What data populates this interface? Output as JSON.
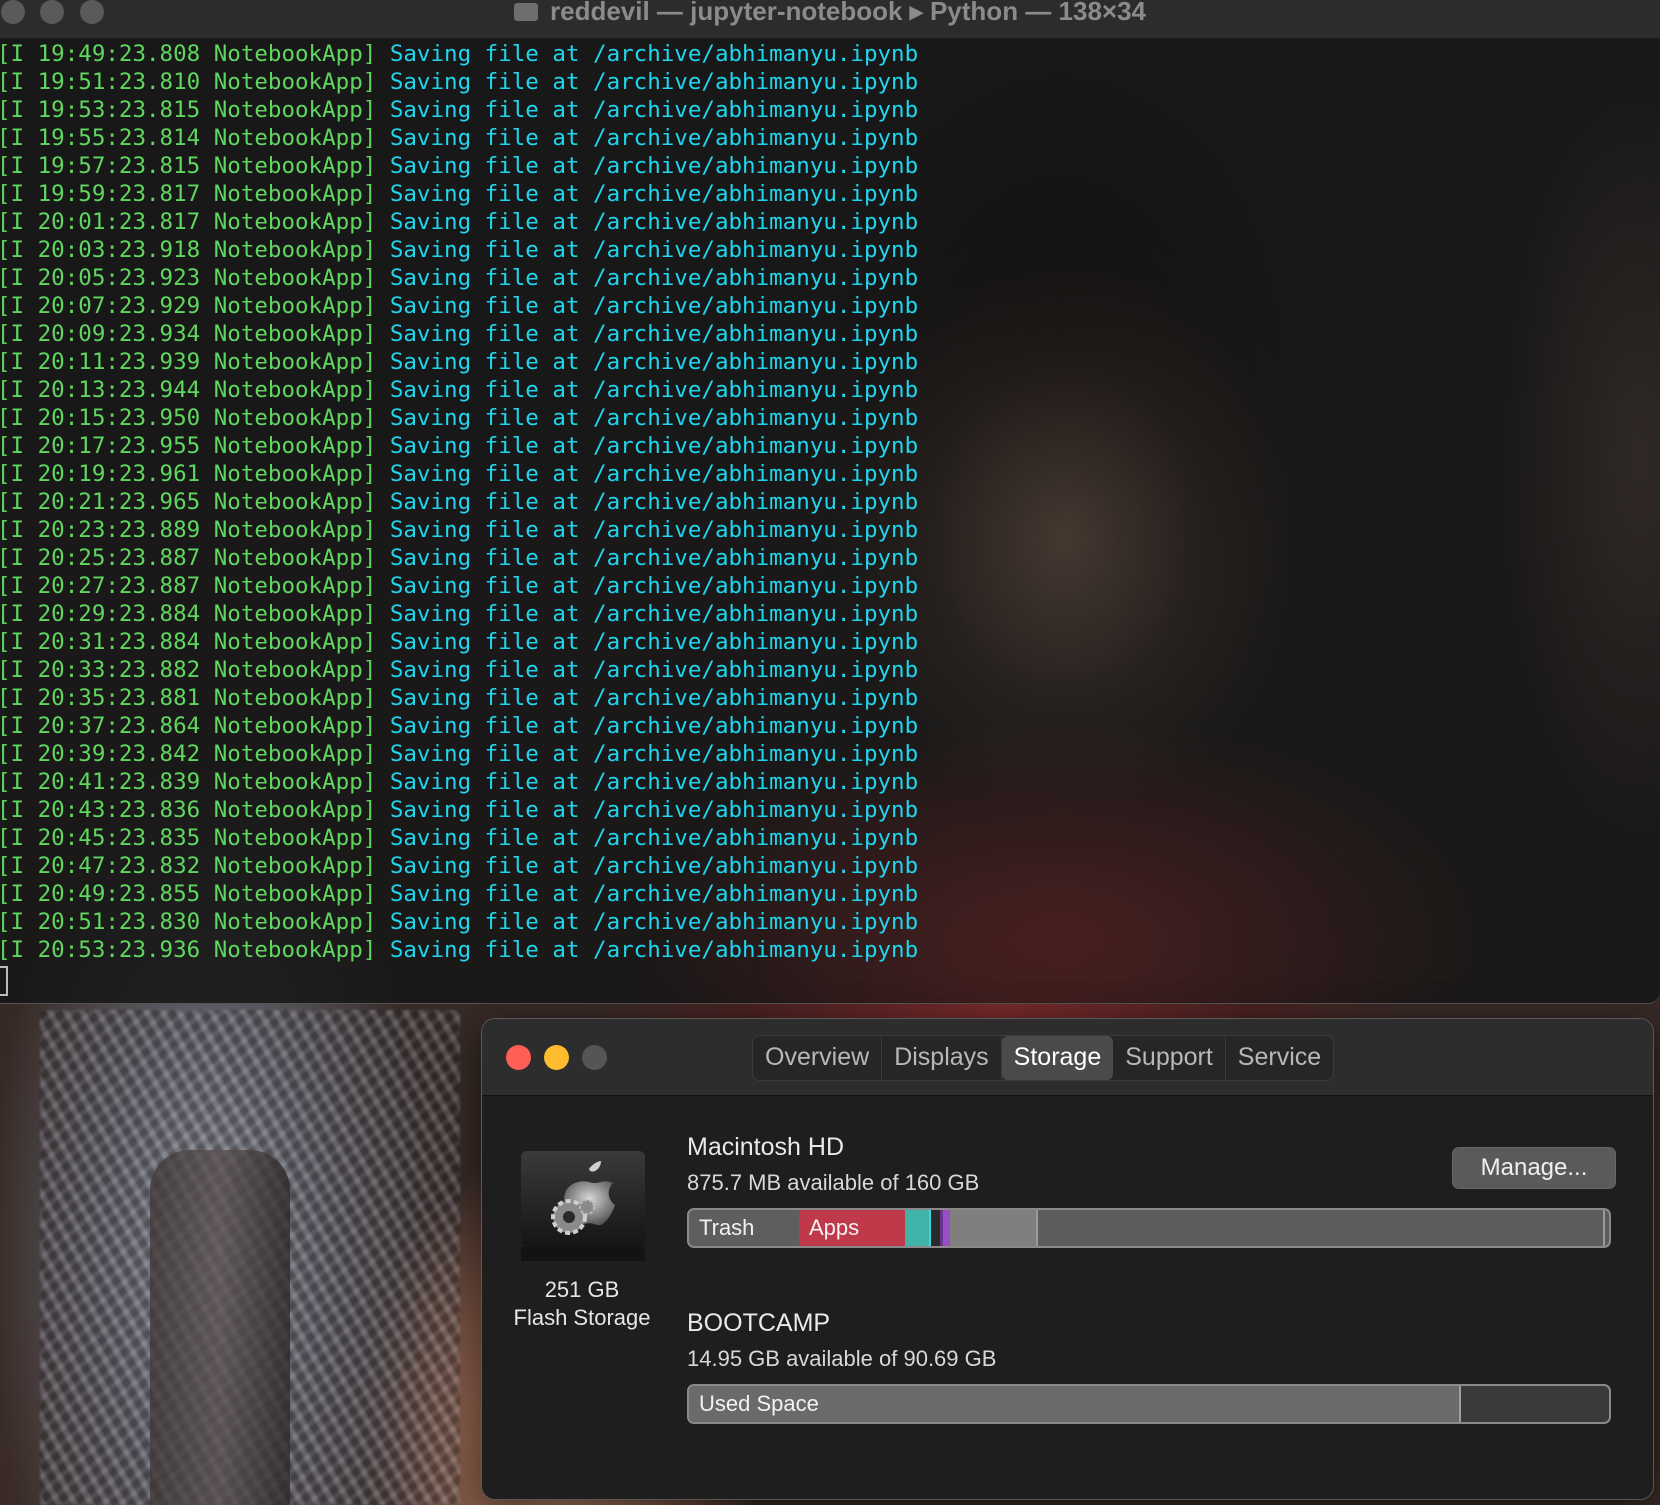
{
  "terminal": {
    "title": "reddevil — jupyter-notebook ▸ Python — 138×34",
    "lines": [
      {
        "prefix": "[I 19:49:23.808 NotebookApp]",
        "message": " Saving file at /archive/abhimanyu.ipynb"
      },
      {
        "prefix": "[I 19:51:23.810 NotebookApp]",
        "message": " Saving file at /archive/abhimanyu.ipynb"
      },
      {
        "prefix": "[I 19:53:23.815 NotebookApp]",
        "message": " Saving file at /archive/abhimanyu.ipynb"
      },
      {
        "prefix": "[I 19:55:23.814 NotebookApp]",
        "message": " Saving file at /archive/abhimanyu.ipynb"
      },
      {
        "prefix": "[I 19:57:23.815 NotebookApp]",
        "message": " Saving file at /archive/abhimanyu.ipynb"
      },
      {
        "prefix": "[I 19:59:23.817 NotebookApp]",
        "message": " Saving file at /archive/abhimanyu.ipynb"
      },
      {
        "prefix": "[I 20:01:23.817 NotebookApp]",
        "message": " Saving file at /archive/abhimanyu.ipynb"
      },
      {
        "prefix": "[I 20:03:23.918 NotebookApp]",
        "message": " Saving file at /archive/abhimanyu.ipynb"
      },
      {
        "prefix": "[I 20:05:23.923 NotebookApp]",
        "message": " Saving file at /archive/abhimanyu.ipynb"
      },
      {
        "prefix": "[I 20:07:23.929 NotebookApp]",
        "message": " Saving file at /archive/abhimanyu.ipynb"
      },
      {
        "prefix": "[I 20:09:23.934 NotebookApp]",
        "message": " Saving file at /archive/abhimanyu.ipynb"
      },
      {
        "prefix": "[I 20:11:23.939 NotebookApp]",
        "message": " Saving file at /archive/abhimanyu.ipynb"
      },
      {
        "prefix": "[I 20:13:23.944 NotebookApp]",
        "message": " Saving file at /archive/abhimanyu.ipynb"
      },
      {
        "prefix": "[I 20:15:23.950 NotebookApp]",
        "message": " Saving file at /archive/abhimanyu.ipynb"
      },
      {
        "prefix": "[I 20:17:23.955 NotebookApp]",
        "message": " Saving file at /archive/abhimanyu.ipynb"
      },
      {
        "prefix": "[I 20:19:23.961 NotebookApp]",
        "message": " Saving file at /archive/abhimanyu.ipynb"
      },
      {
        "prefix": "[I 20:21:23.965 NotebookApp]",
        "message": " Saving file at /archive/abhimanyu.ipynb"
      },
      {
        "prefix": "[I 20:23:23.889 NotebookApp]",
        "message": " Saving file at /archive/abhimanyu.ipynb"
      },
      {
        "prefix": "[I 20:25:23.887 NotebookApp]",
        "message": " Saving file at /archive/abhimanyu.ipynb"
      },
      {
        "prefix": "[I 20:27:23.887 NotebookApp]",
        "message": " Saving file at /archive/abhimanyu.ipynb"
      },
      {
        "prefix": "[I 20:29:23.884 NotebookApp]",
        "message": " Saving file at /archive/abhimanyu.ipynb"
      },
      {
        "prefix": "[I 20:31:23.884 NotebookApp]",
        "message": " Saving file at /archive/abhimanyu.ipynb"
      },
      {
        "prefix": "[I 20:33:23.882 NotebookApp]",
        "message": " Saving file at /archive/abhimanyu.ipynb"
      },
      {
        "prefix": "[I 20:35:23.881 NotebookApp]",
        "message": " Saving file at /archive/abhimanyu.ipynb"
      },
      {
        "prefix": "[I 20:37:23.864 NotebookApp]",
        "message": " Saving file at /archive/abhimanyu.ipynb"
      },
      {
        "prefix": "[I 20:39:23.842 NotebookApp]",
        "message": " Saving file at /archive/abhimanyu.ipynb"
      },
      {
        "prefix": "[I 20:41:23.839 NotebookApp]",
        "message": " Saving file at /archive/abhimanyu.ipynb"
      },
      {
        "prefix": "[I 20:43:23.836 NotebookApp]",
        "message": " Saving file at /archive/abhimanyu.ipynb"
      },
      {
        "prefix": "[I 20:45:23.835 NotebookApp]",
        "message": " Saving file at /archive/abhimanyu.ipynb"
      },
      {
        "prefix": "[I 20:47:23.832 NotebookApp]",
        "message": " Saving file at /archive/abhimanyu.ipynb"
      },
      {
        "prefix": "[I 20:49:23.855 NotebookApp]",
        "message": " Saving file at /archive/abhimanyu.ipynb"
      },
      {
        "prefix": "[I 20:51:23.830 NotebookApp]",
        "message": " Saving file at /archive/abhimanyu.ipynb"
      },
      {
        "prefix": "[I 20:53:23.936 NotebookApp]",
        "message": " Saving file at /archive/abhimanyu.ipynb"
      }
    ],
    "colors": {
      "prefix": "#5fd75f",
      "message": "#1fd6ee"
    }
  },
  "about": {
    "tabs": [
      "Overview",
      "Displays",
      "Storage",
      "Support",
      "Service"
    ],
    "active_tab": "Storage",
    "device": {
      "capacity": "251 GB",
      "type": "Flash Storage",
      "icon": "hard-drive-icon"
    },
    "volumes": [
      {
        "name": "Macintosh HD",
        "available": "875.7 MB available of 160 GB",
        "manage_label": "Manage...",
        "segments": [
          {
            "label": "Trash",
            "color": "#5e5e5e"
          },
          {
            "label": "Apps",
            "color": "#c0394a"
          },
          {
            "label": "",
            "color": "#3fb3a8"
          },
          {
            "label": "",
            "color": "#3fd2e8"
          },
          {
            "label": "",
            "color": "#9a4fc6"
          },
          {
            "label": "",
            "color": "#7f7f7f"
          }
        ]
      },
      {
        "name": "BOOTCAMP",
        "available": "14.95 GB available of 90.69 GB",
        "segments": [
          {
            "label": "Used Space",
            "color": "#6a6a6a"
          }
        ]
      }
    ]
  }
}
